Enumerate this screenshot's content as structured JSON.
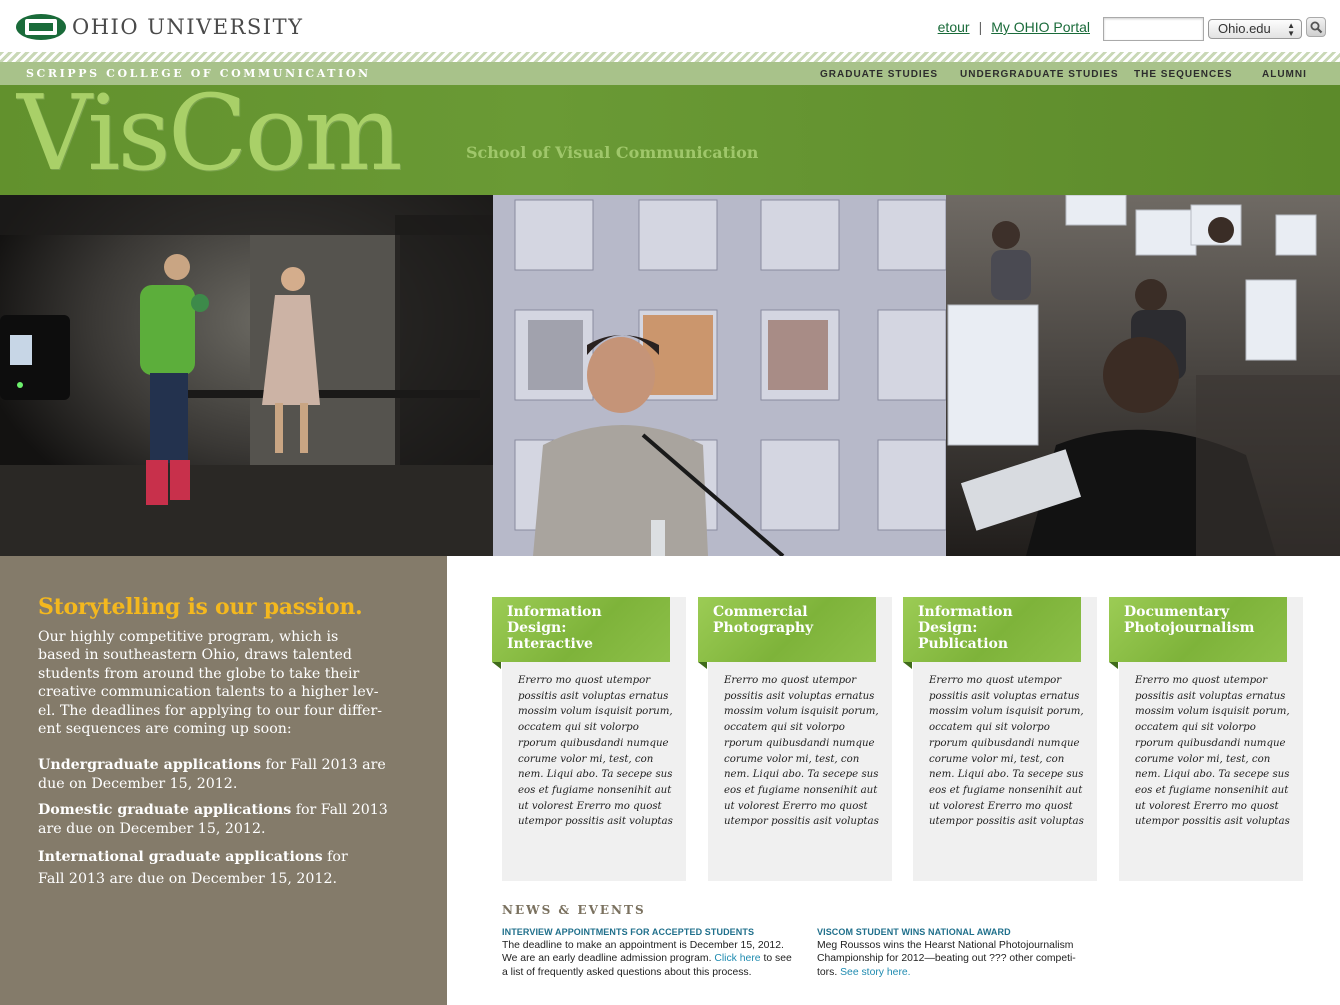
{
  "topbar": {
    "university": "OHIO UNIVERSITY",
    "links": [
      "etour",
      "My OHIO Portal"
    ],
    "separator": "|",
    "search_placeholder": "",
    "site_select": "Ohio.edu"
  },
  "nav": {
    "college": "SCRIPPS COLLEGE OF COMMUNICATION",
    "items": [
      "GRADUATE STUDIES",
      "UNDERGRADUATE STUDIES",
      "THE SEQUENCES",
      "ALUMNI"
    ]
  },
  "header": {
    "title": "VisCom",
    "tagline": "School of Visual Communication"
  },
  "intro": {
    "heading": "Storytelling is our passion.",
    "lines": [
      "Our highly competitive program, which is",
      "based in southeastern Ohio, draws talented",
      "students from around the globe to take their",
      "creative communication talents to a higher lev-",
      "el. The deadlines for applying to our four differ-",
      "ent sequences are coming up soon:"
    ],
    "deadlines": [
      {
        "bold": "Undergraduate applications",
        "rest1": " for Fall 2013 are",
        "rest2": "due on December 15, 2012."
      },
      {
        "bold": "Domestic graduate applications",
        "rest1": " for Fall 2013",
        "rest2": "are due on December 15, 2012."
      },
      {
        "bold": "International graduate applications",
        "rest1": " for",
        "rest2": "Fall 2013 are due on December 15, 2012."
      }
    ]
  },
  "cards": [
    {
      "title_lines": [
        "Information",
        "Design:",
        "Interactive"
      ]
    },
    {
      "title_lines": [
        "Commercial",
        "Photography"
      ]
    },
    {
      "title_lines": [
        "Information",
        "Design:",
        "Publication"
      ]
    },
    {
      "title_lines": [
        "Documentary",
        "Photojournalism"
      ]
    }
  ],
  "card_text_lines": [
    "Ererro mo quost utempor",
    "possitis asit voluptas ernatus",
    "mossim volum isquisit porum,",
    "occatem qui sit volorpo",
    "rporum quibusdandi numque",
    "corume volor mi, test, con",
    "nem. Liqui abo. Ta secepe sus",
    "eos et fugiame nonsenihit aut",
    "ut volorest Ererro mo quost",
    "utempor possitis asit voluptas"
  ],
  "news": {
    "heading": "NEWS & EVENTS",
    "items": [
      {
        "title": "INTERVIEW APPOINTMENTS FOR ACCEPTED STUDENTS",
        "line1": "The deadline to make an appointment is December 15, 2012.",
        "line2a": "We are an early deadline admission program. ",
        "link": "Click here",
        "line2b": " to see",
        "line3": "a list of frequently asked questions about this process."
      },
      {
        "title": "VISCOM STUDENT WINS NATIONAL AWARD",
        "line1": "Meg Roussos wins the Hearst National Photojournalism",
        "line2a": "Championship for 2012—beating out ??? other competi-",
        "link": "See story here.",
        "line2b": "",
        "line3": "tors. "
      }
    ]
  },
  "colors": {
    "brand_green": "#62912d",
    "nav_band": "#a8c28a",
    "left_panel": "#847b6a",
    "heading_gold": "#f4b81e",
    "link_blue": "#1f6f8b"
  }
}
